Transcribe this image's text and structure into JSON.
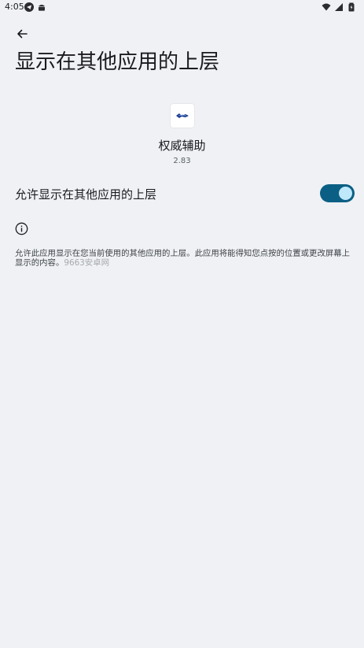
{
  "status_bar": {
    "time": "4:05",
    "left_icons": [
      "telegram-icon",
      "android-icon"
    ],
    "right_icons": [
      "wifi-icon",
      "signal-icon",
      "battery-icon"
    ]
  },
  "header": {
    "title": "显示在其他应用的上层"
  },
  "app": {
    "name": "权威辅助",
    "version": "2.83"
  },
  "setting": {
    "label": "允许显示在其他应用的上层",
    "enabled": true
  },
  "info": {
    "description": "允许此应用显示在您当前使用的其他应用的上层。此应用将能得知您点按的位置或更改屏幕上显示的内容。",
    "watermark": "9663安卓网"
  },
  "colors": {
    "background": "#eff1f4",
    "switch_track": "#0b5f84",
    "switch_thumb": "#bfe8fb"
  }
}
